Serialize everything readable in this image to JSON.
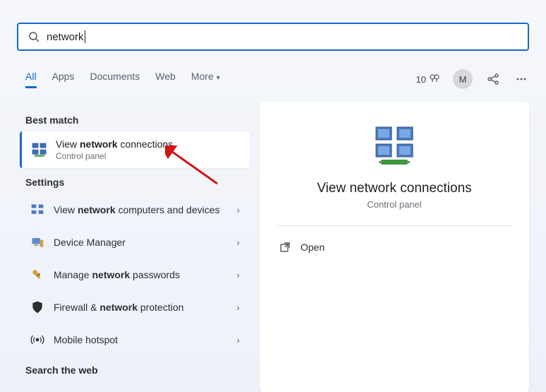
{
  "search": {
    "value": "network"
  },
  "tabs": {
    "items": [
      "All",
      "Apps",
      "Documents",
      "Web",
      "More"
    ],
    "active": 0
  },
  "header_right": {
    "rewards_count": "10",
    "avatar_initial": "M"
  },
  "left": {
    "best_match_header": "Best match",
    "best_match": {
      "title_pre": "View ",
      "title_bold": "network",
      "title_post": " connections",
      "subtitle": "Control panel"
    },
    "settings_header": "Settings",
    "settings": [
      {
        "pre": "View ",
        "bold": "network",
        "post": " computers and devices",
        "icon": "network-computers-icon"
      },
      {
        "pre": "",
        "bold": "",
        "post": "Device Manager",
        "icon": "device-manager-icon"
      },
      {
        "pre": "Manage ",
        "bold": "network",
        "post": " passwords",
        "icon": "keys-icon"
      },
      {
        "pre": "Firewall & ",
        "bold": "network",
        "post": " protection",
        "icon": "shield-icon"
      },
      {
        "pre": "",
        "bold": "",
        "post": "Mobile hotspot",
        "icon": "hotspot-icon"
      }
    ],
    "search_web_header": "Search the web"
  },
  "right": {
    "title": "View network connections",
    "subtitle": "Control panel",
    "open_label": "Open"
  }
}
